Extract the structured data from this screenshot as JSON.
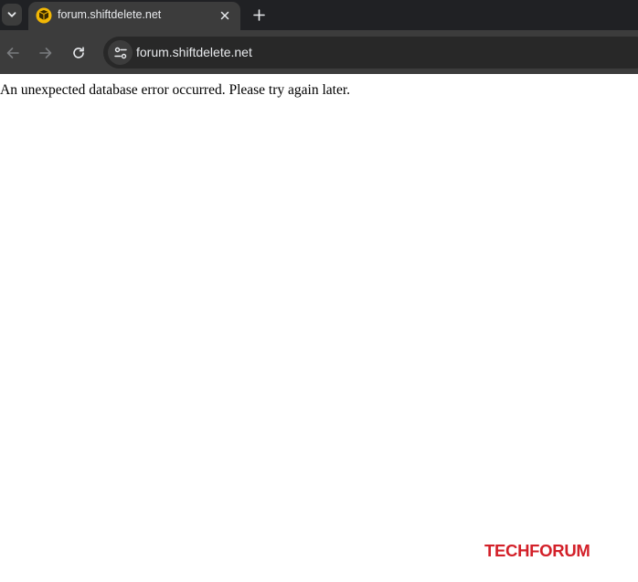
{
  "browser": {
    "tab": {
      "title": "forum.shiftdelete.net",
      "favicon": "shiftdelete-logo-icon",
      "close_icon": "close-icon"
    },
    "tab_search_icon": "chevron-down-icon",
    "new_tab_icon": "plus-icon",
    "toolbar": {
      "back_icon": "arrow-left-icon",
      "forward_icon": "arrow-right-icon",
      "reload_icon": "reload-icon",
      "site_info_icon": "tune-icon",
      "url": "forum.shiftdelete.net"
    },
    "colors": {
      "tabstrip": "#202124",
      "toolbar": "#3c3c3c",
      "omnibox": "#282828",
      "text": "#e8eaed"
    }
  },
  "page": {
    "error_message": "An unexpected database error occurred. Please try again later.",
    "watermark": {
      "part1": "TECH",
      "part2": "FORUM",
      "color": "#d32029"
    }
  }
}
